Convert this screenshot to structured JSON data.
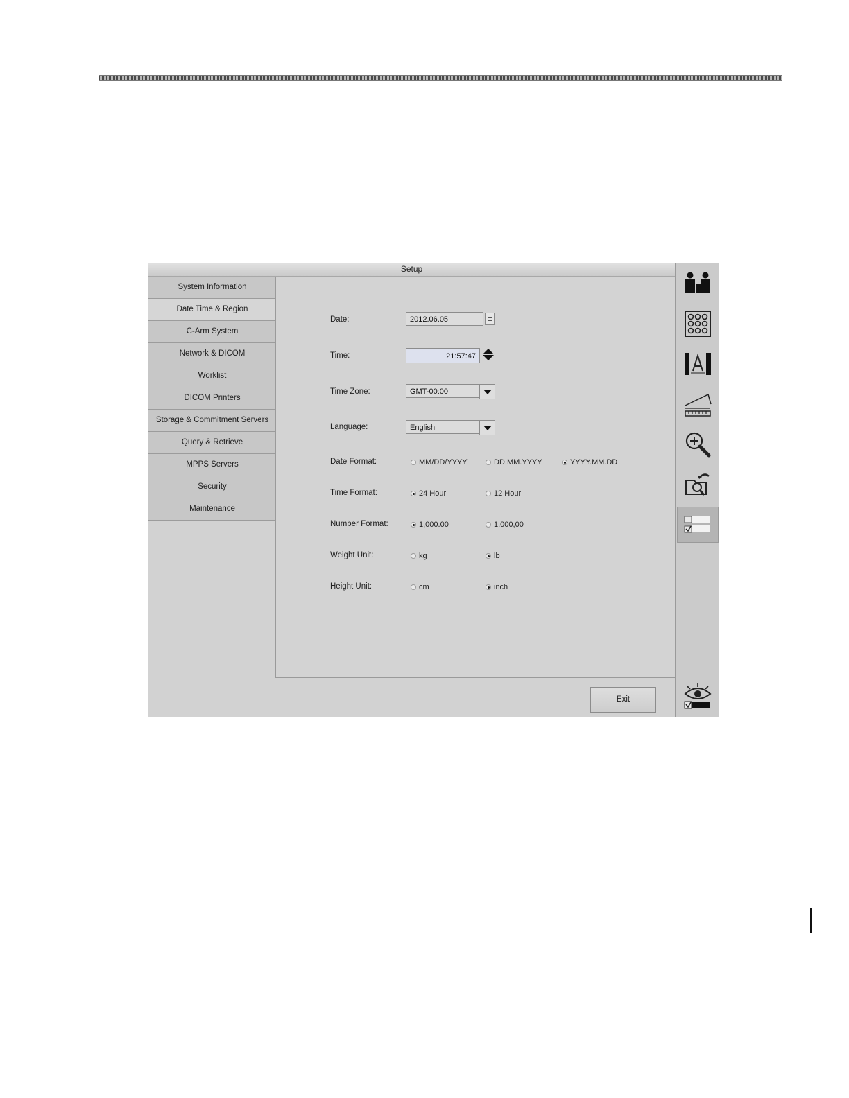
{
  "window": {
    "title": "Setup"
  },
  "nav": {
    "items": [
      {
        "label": "System Information",
        "active": false
      },
      {
        "label": "Date Time & Region",
        "active": true
      },
      {
        "label": "C-Arm System",
        "active": false
      },
      {
        "label": "Network & DICOM",
        "active": false
      },
      {
        "label": "Worklist",
        "active": false
      },
      {
        "label": "DICOM Printers",
        "active": false
      },
      {
        "label": "Storage & Commitment Servers",
        "active": false
      },
      {
        "label": "Query & Retrieve",
        "active": false
      },
      {
        "label": "MPPS Servers",
        "active": false
      },
      {
        "label": "Security",
        "active": false
      },
      {
        "label": "Maintenance",
        "active": false
      }
    ]
  },
  "form": {
    "date": {
      "label": "Date:",
      "value": "2012.06.05"
    },
    "time": {
      "label": "Time:",
      "value": "21:57:47"
    },
    "time_zone": {
      "label": "Time Zone:",
      "value": "GMT-00:00"
    },
    "language": {
      "label": "Language:",
      "value": "English"
    },
    "date_format": {
      "label": "Date Format:",
      "options": [
        "MM/DD/YYYY",
        "DD.MM.YYYY",
        "YYYY.MM.DD"
      ],
      "selected": "YYYY.MM.DD"
    },
    "time_format": {
      "label": "Time Format:",
      "options": [
        "24 Hour",
        "12 Hour"
      ],
      "selected": "24 Hour"
    },
    "number_format": {
      "label": "Number Format:",
      "options": [
        "1,000.00",
        "1.000,00"
      ],
      "selected": "1,000.00"
    },
    "weight_unit": {
      "label": "Weight Unit:",
      "options": [
        "kg",
        "lb"
      ],
      "selected": "lb"
    },
    "height_unit": {
      "label": "Height Unit:",
      "options": [
        "cm",
        "inch"
      ],
      "selected": "inch"
    }
  },
  "footer": {
    "exit_label": "Exit"
  },
  "toolbar": {
    "icons": [
      "patient-info-icon",
      "image-grid-icon",
      "annotation-text-icon",
      "measurement-icon",
      "zoom-icon",
      "review-folder-icon",
      "setup-settings-icon",
      "view-options-icon"
    ],
    "active": "setup-settings-icon"
  },
  "colors": {
    "panel": "#d2d2d2",
    "nav": "#c7c7c7",
    "active_tool": "#b4b4b4",
    "time_field": "#dde1ee"
  }
}
